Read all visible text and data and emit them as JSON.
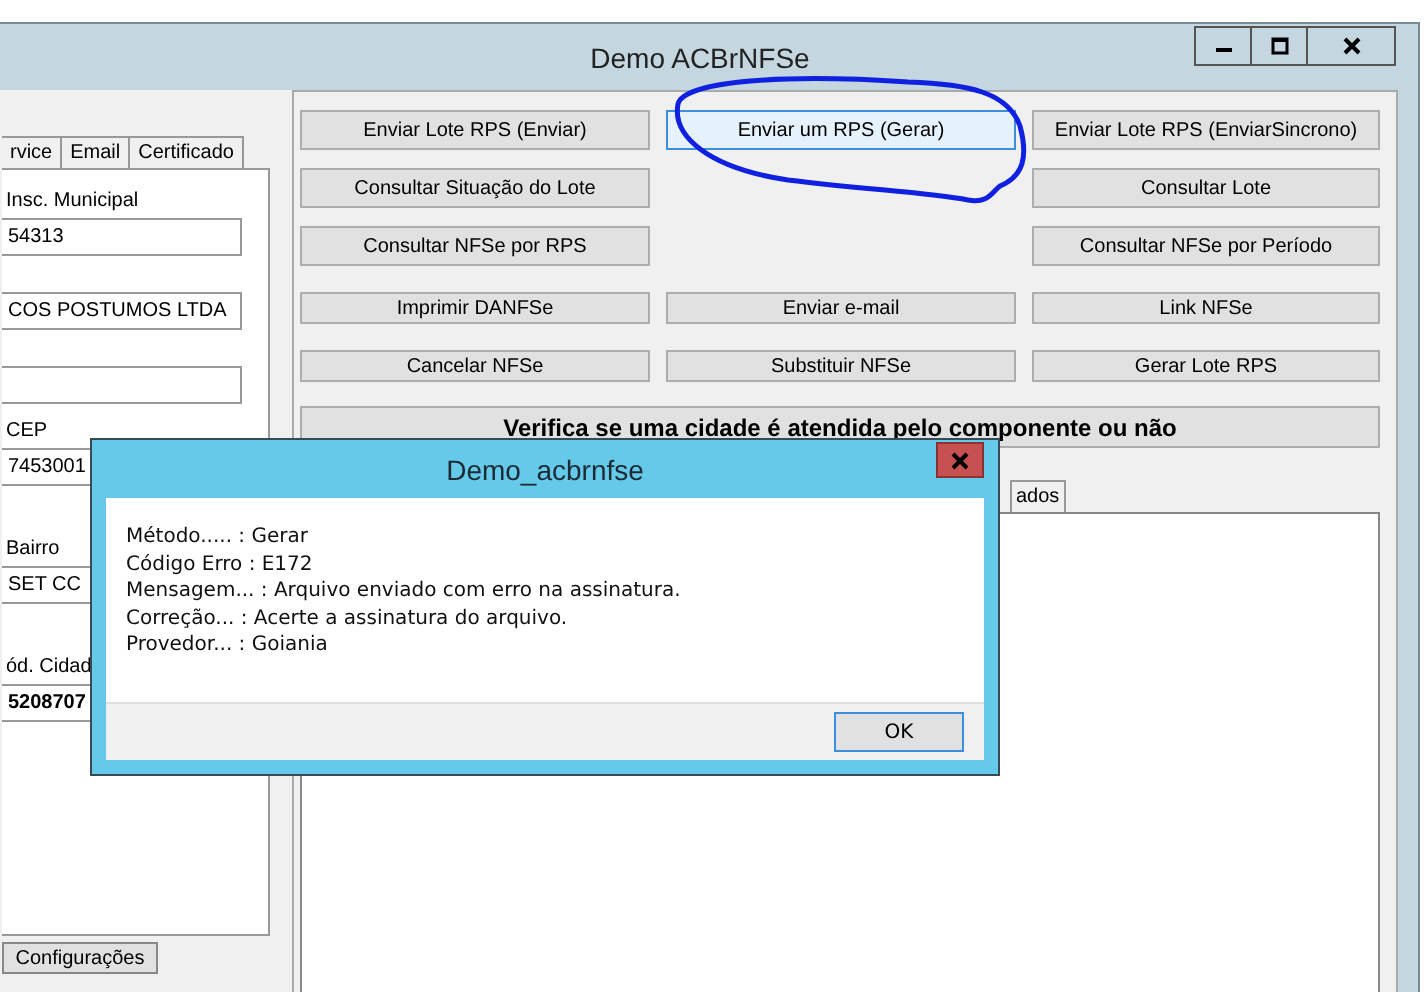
{
  "window": {
    "title": "Demo ACBrNFSe"
  },
  "left_panel": {
    "tabs": [
      {
        "label": "rvice",
        "selected": false
      },
      {
        "label": "Email",
        "selected": false
      },
      {
        "label": "Certificado",
        "selected": false
      }
    ],
    "fields": [
      {
        "label": "Insc. Municipal",
        "value": "54313"
      },
      {
        "value": "COS POSTUMOS LTDA"
      },
      {
        "kind": "blank"
      },
      {
        "label": "CEP",
        "value": "7453001"
      },
      {
        "label": "Bairro",
        "value": "SET CC"
      },
      {
        "label": "ód. Cidad",
        "value": "5208707",
        "kind": "bold"
      }
    ],
    "bottom_button": "Configurações"
  },
  "actions": [
    {
      "left": {
        "label": "Enviar Lote RPS (Enviar)",
        "focused": false
      },
      "middle": {
        "label": "Enviar um RPS (Gerar)",
        "focused": true
      },
      "right": {
        "label": "Enviar Lote RPS (EnviarSincrono)",
        "focused": false
      }
    },
    {
      "left": {
        "label": "Consultar Situação do Lote",
        "focused": false
      },
      "right": {
        "label": "Consultar Lote",
        "focused": false
      }
    },
    {
      "left": {
        "label": "Consultar NFSe por RPS",
        "focused": false
      },
      "right": {
        "label": "Consultar NFSe por Período",
        "focused": false
      }
    },
    {
      "left": {
        "label": "Imprimir DANFSe",
        "focused": false
      },
      "middle": {
        "label": "Enviar e-mail",
        "focused": false
      },
      "right": {
        "label": "Link NFSe",
        "focused": false
      }
    },
    {
      "left": {
        "label": "Cancelar NFSe",
        "focused": false
      },
      "middle": {
        "label": "Substituir NFSe",
        "focused": false
      },
      "right": {
        "label": "Gerar Lote RPS",
        "focused": false
      }
    }
  ],
  "check_city_button": "Verifica se uma cidade é atendida pelo componente ou não",
  "result_tabs": [
    {
      "label": "ados",
      "selected": false
    }
  ],
  "dialog": {
    "title": "Demo_acbrnfse",
    "lines": [
      "Método..... : Gerar",
      "Código Erro : E172",
      "Mensagem... : Arquivo enviado com erro na assinatura.",
      "Correção... : Acerte a assinatura do arquivo.",
      "Provedor... : Goiania"
    ],
    "ok_button": "OK"
  }
}
